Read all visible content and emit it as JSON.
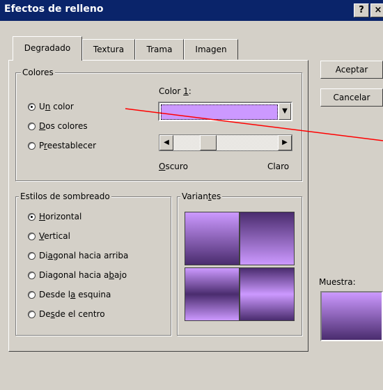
{
  "window": {
    "title": "Efectos de relleno",
    "help_label": "?",
    "close_label": "×"
  },
  "tabs": [
    {
      "label": "Degradado",
      "active": true
    },
    {
      "label": "Textura"
    },
    {
      "label": "Trama"
    },
    {
      "label": "Imagen"
    }
  ],
  "buttons": {
    "ok": "Aceptar",
    "cancel": "Cancelar"
  },
  "colors": {
    "legend": "Colores",
    "options": [
      {
        "prefix": "U",
        "accel": "n",
        "rest": " color",
        "checked": true
      },
      {
        "prefix": "",
        "accel": "D",
        "rest": "os colores"
      },
      {
        "prefix": "P",
        "accel": "r",
        "rest": "eestablecer"
      }
    ],
    "color1": {
      "prefix": "Color ",
      "accel": "1",
      "rest": ":"
    },
    "color1_value": "#cc99ff",
    "slider": {
      "left_accel": "O",
      "left_rest": "scuro",
      "right": "Claro",
      "value": 0.3
    }
  },
  "shading": {
    "legend": "Estilos de sombreado",
    "options": [
      {
        "prefix": "",
        "accel": "H",
        "rest": "orizontal",
        "checked": true
      },
      {
        "prefix": "",
        "accel": "V",
        "rest": "ertical"
      },
      {
        "prefix": "Di",
        "accel": "a",
        "rest": "gonal hacia arriba"
      },
      {
        "prefix": "Diagonal hacia a",
        "accel": "b",
        "rest": "ajo"
      },
      {
        "prefix": "Desde l",
        "accel": "a",
        "rest": " esquina"
      },
      {
        "prefix": "De",
        "accel": "s",
        "rest": "de el centro"
      }
    ]
  },
  "variants": {
    "prefix": "Varian",
    "accel": "t",
    "rest": "es"
  },
  "preview": {
    "label": "Muestra:"
  },
  "theme": {
    "light": "#cc99ff",
    "dark": "#4a2c6e",
    "annotation": "#ff0000"
  }
}
